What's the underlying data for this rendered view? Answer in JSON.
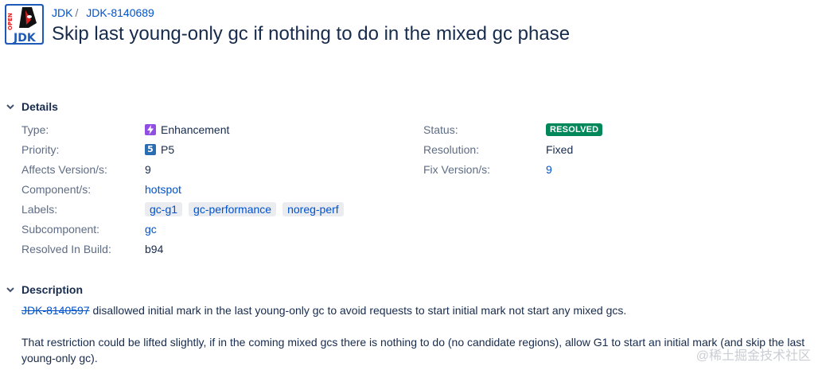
{
  "breadcrumb": {
    "project": "JDK",
    "issue_key": "JDK-8140689"
  },
  "issue_title": "Skip last young-only gc if nothing to do in the mixed gc phase",
  "details": {
    "heading": "Details",
    "left": {
      "type_label": "Type:",
      "type_value": "Enhancement",
      "priority_label": "Priority:",
      "priority_value": "P5",
      "priority_icon_text": "5",
      "affects_label": "Affects Version/s:",
      "affects_value": "9",
      "component_label": "Component/s:",
      "component_value": "hotspot",
      "labels_label": "Labels:",
      "labels": [
        "gc-g1",
        "gc-performance",
        "noreg-perf"
      ],
      "subcomponent_label": "Subcomponent:",
      "subcomponent_value": "gc",
      "resolved_build_label": "Resolved In Build:",
      "resolved_build_value": "b94"
    },
    "right": {
      "status_label": "Status:",
      "status_value": "RESOLVED",
      "resolution_label": "Resolution:",
      "resolution_value": "Fixed",
      "fix_version_label": "Fix Version/s:",
      "fix_version_value": "9"
    }
  },
  "description": {
    "heading": "Description",
    "linked_issue": "JDK-8140597",
    "para1_rest": " disallowed initial mark in the last young-only gc to avoid requests to start initial mark not start any mixed gcs.",
    "para2": "That restriction could be lifted slightly, if in the coming mixed gcs there is nothing to do (no candidate regions), allow G1 to start an initial mark (and skip the last young-only gc)."
  },
  "watermark": "@稀土掘金技术社区",
  "colors": {
    "link": "#0052cc",
    "status": "#00875a",
    "type_icon": "#904ee2",
    "priority_icon": "#2a6db0"
  },
  "icons": {
    "logo": "openjdk-duke-logo",
    "type": "enhancement-lightning-icon",
    "priority": "priority-5-icon",
    "twisty": "chevron-down-icon"
  }
}
